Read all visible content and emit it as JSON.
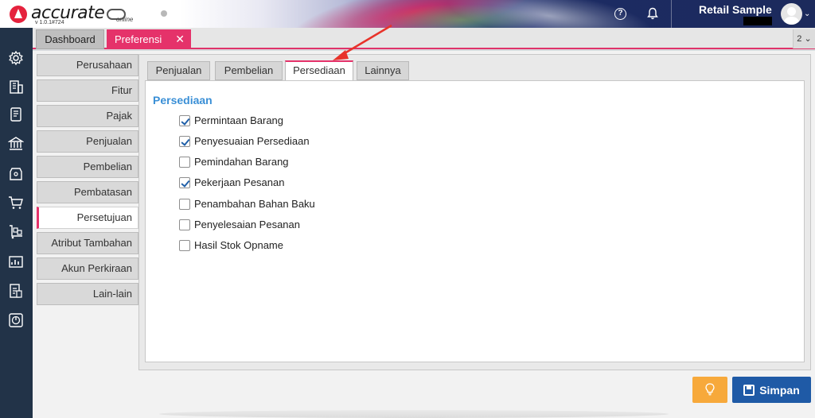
{
  "app": {
    "logo_text": "accurate",
    "logo_online": "online",
    "version": "v 1.0.1#724",
    "company_name": "Retail Sample",
    "help_icon": "question-circle-icon",
    "bell_icon": "bell-icon",
    "avatar_icon": "user-avatar-icon"
  },
  "tabs": {
    "dashboard": "Dashboard",
    "preferensi": "Preferensi",
    "close_glyph": "✕",
    "count": "2 ⌄"
  },
  "sidebar": {
    "items": [
      {
        "label": "Perusahaan"
      },
      {
        "label": "Fitur"
      },
      {
        "label": "Pajak"
      },
      {
        "label": "Penjualan"
      },
      {
        "label": "Pembelian"
      },
      {
        "label": "Pembatasan"
      },
      {
        "label": "Persetujuan",
        "active": true
      },
      {
        "label": "Atribut Tambahan"
      },
      {
        "label": "Akun Perkiraan"
      },
      {
        "label": "Lain-lain"
      }
    ]
  },
  "subtabs": [
    {
      "label": "Penjualan"
    },
    {
      "label": "Pembelian"
    },
    {
      "label": "Persediaan",
      "active": true
    },
    {
      "label": "Lainnya"
    }
  ],
  "section": {
    "title": "Persediaan",
    "options": [
      {
        "label": "Permintaan Barang",
        "checked": true
      },
      {
        "label": "Penyesuaian Persediaan",
        "checked": true
      },
      {
        "label": "Pemindahan Barang",
        "checked": false
      },
      {
        "label": "Pekerjaan Pesanan",
        "checked": true
      },
      {
        "label": "Penambahan Bahan Baku",
        "checked": false
      },
      {
        "label": "Penyelesaian Pesanan",
        "checked": false
      },
      {
        "label": "Hasil Stok Opname",
        "checked": false
      }
    ]
  },
  "buttons": {
    "save": "Simpan",
    "tip_icon": "lightbulb-icon",
    "save_icon": "floppy-disk-icon"
  },
  "colors": {
    "accent_pink": "#e5326a",
    "primary_blue": "#1f5aa6",
    "section_blue": "#3a8fd6",
    "warning_orange": "#f7a93b",
    "rail_navy": "#223348",
    "annotation_red": "#e8332a"
  }
}
